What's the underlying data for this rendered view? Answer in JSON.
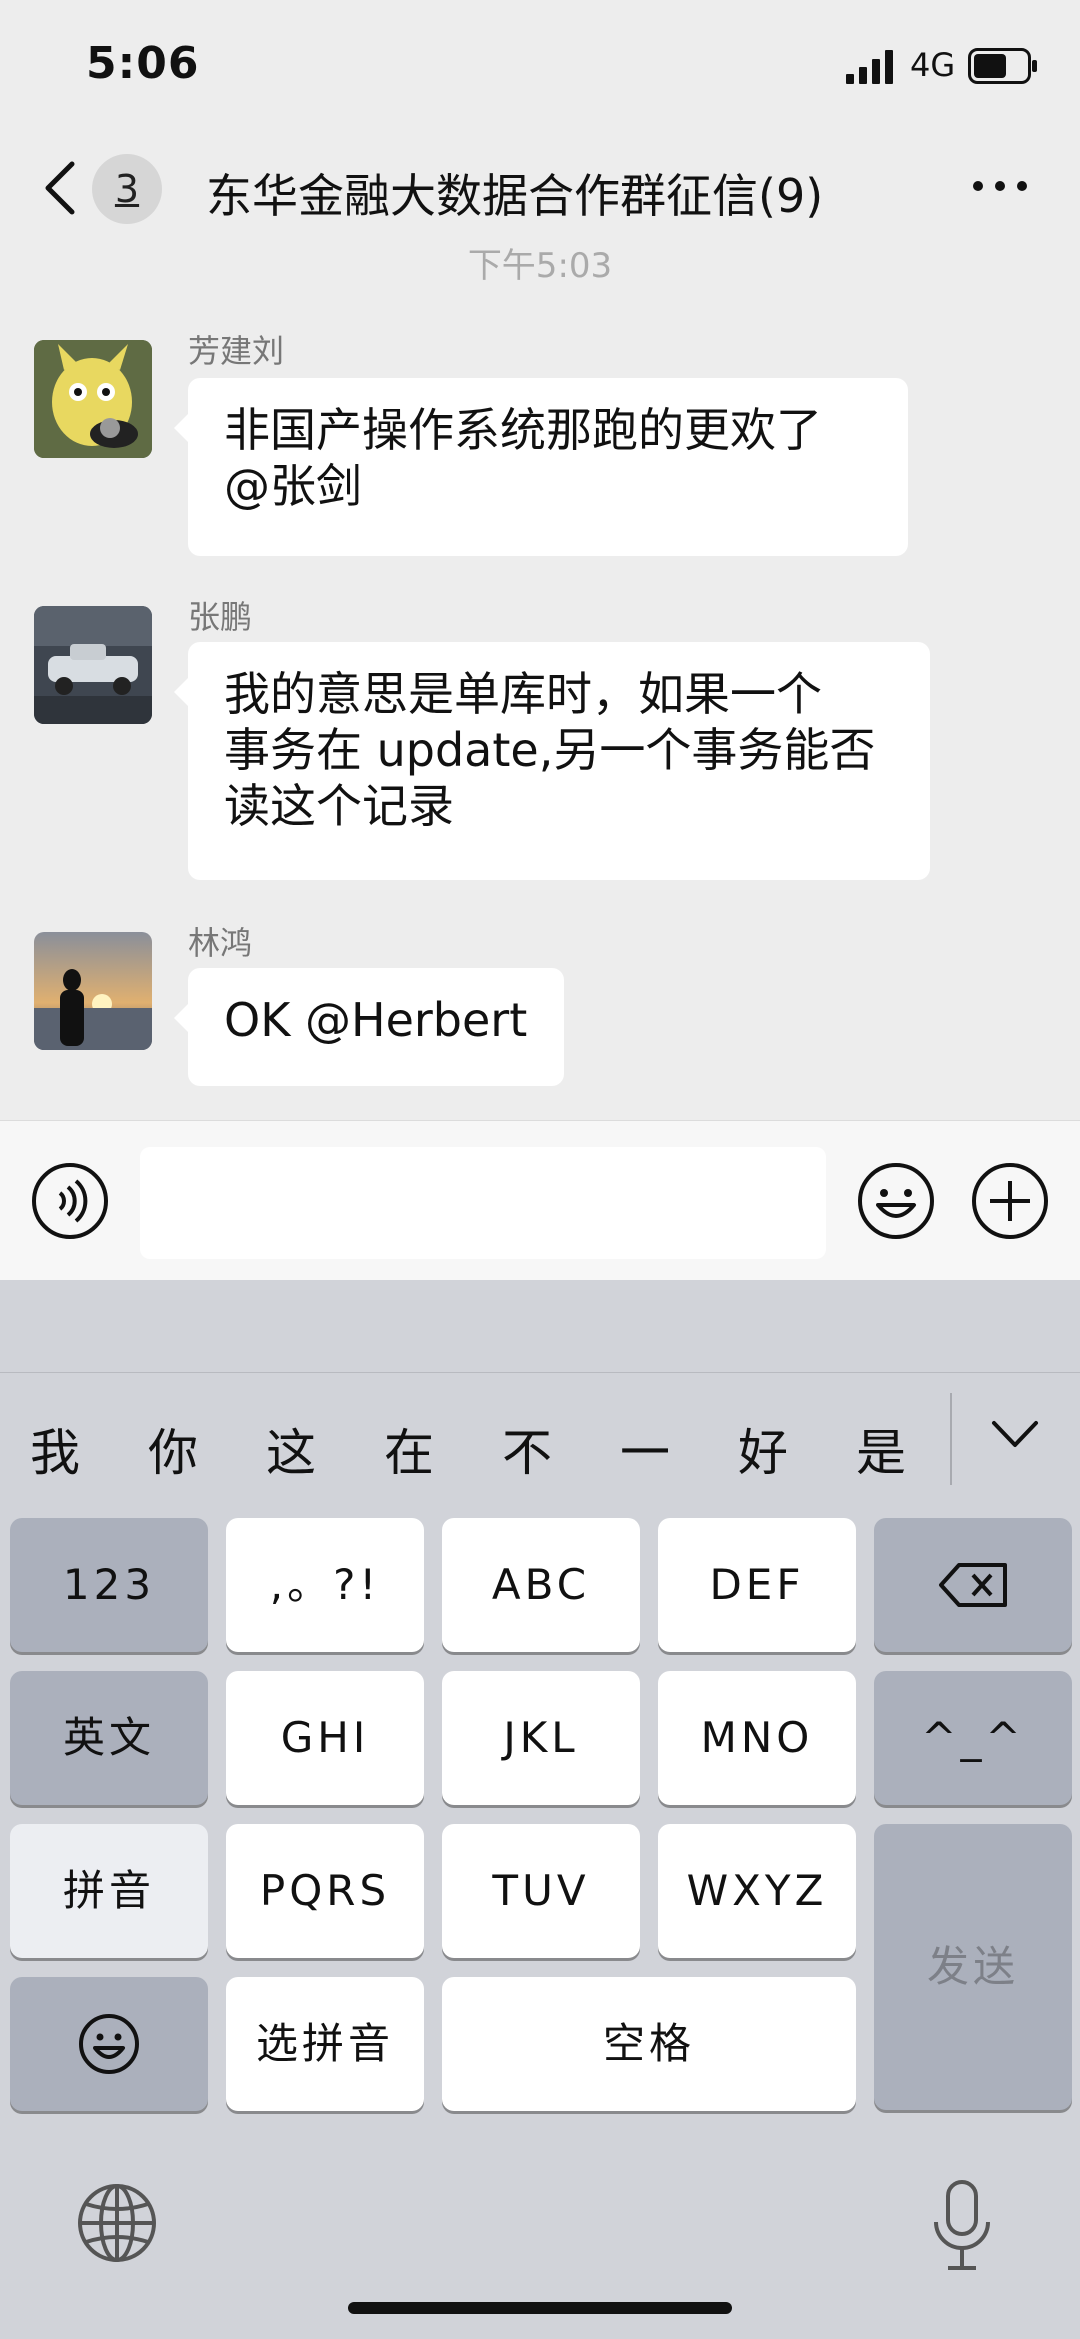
{
  "status_bar": {
    "time": "5:06",
    "network": "4G"
  },
  "header": {
    "unread_count": "3",
    "title": "东华金融大数据合作群征信(9)"
  },
  "timestamp": "下午5:03",
  "messages": [
    {
      "sender": "芳建刘",
      "lines": [
        "非国产操作系统那跑的更欢了",
        "@张剑"
      ]
    },
    {
      "sender": "张鹏",
      "lines": [
        "我的意思是单库时，如果一个",
        "事务在 update,另一个事务能否",
        "读这个记录"
      ]
    },
    {
      "sender": "林鸿",
      "lines": [
        "OK @Herbert"
      ]
    }
  ],
  "input": {
    "value": ""
  },
  "keyboard": {
    "candidates": [
      "我",
      "你",
      "这",
      "在",
      "不",
      "一",
      "好",
      "是"
    ],
    "rows": [
      [
        "123",
        ",。?!",
        "ABC",
        "DEF",
        "delete"
      ],
      [
        "英文",
        "GHI",
        "JKL",
        "MNO",
        "^_^"
      ],
      [
        "拼音",
        "PQRS",
        "TUV",
        "WXYZ",
        "发送"
      ],
      [
        "emoji",
        "选拼音",
        "空格"
      ]
    ],
    "keys": {
      "num": "123",
      "punct": ",。?!",
      "abc": "ABC",
      "def": "DEF",
      "english": "英文",
      "ghi": "GHI",
      "jkl": "JKL",
      "mno": "MNO",
      "kaomoji": "^_^",
      "pinyin": "拼音",
      "pqrs": "PQRS",
      "tuv": "TUV",
      "wxyz": "WXYZ",
      "send": "发送",
      "select_pinyin": "选拼音",
      "space": "空格"
    }
  },
  "icons": [
    "back-chevron-icon",
    "more-icon",
    "voice-icon",
    "emoji-icon",
    "plus-icon",
    "backspace-icon",
    "chevron-down-icon",
    "smiley-icon",
    "globe-icon",
    "microphone-icon"
  ]
}
